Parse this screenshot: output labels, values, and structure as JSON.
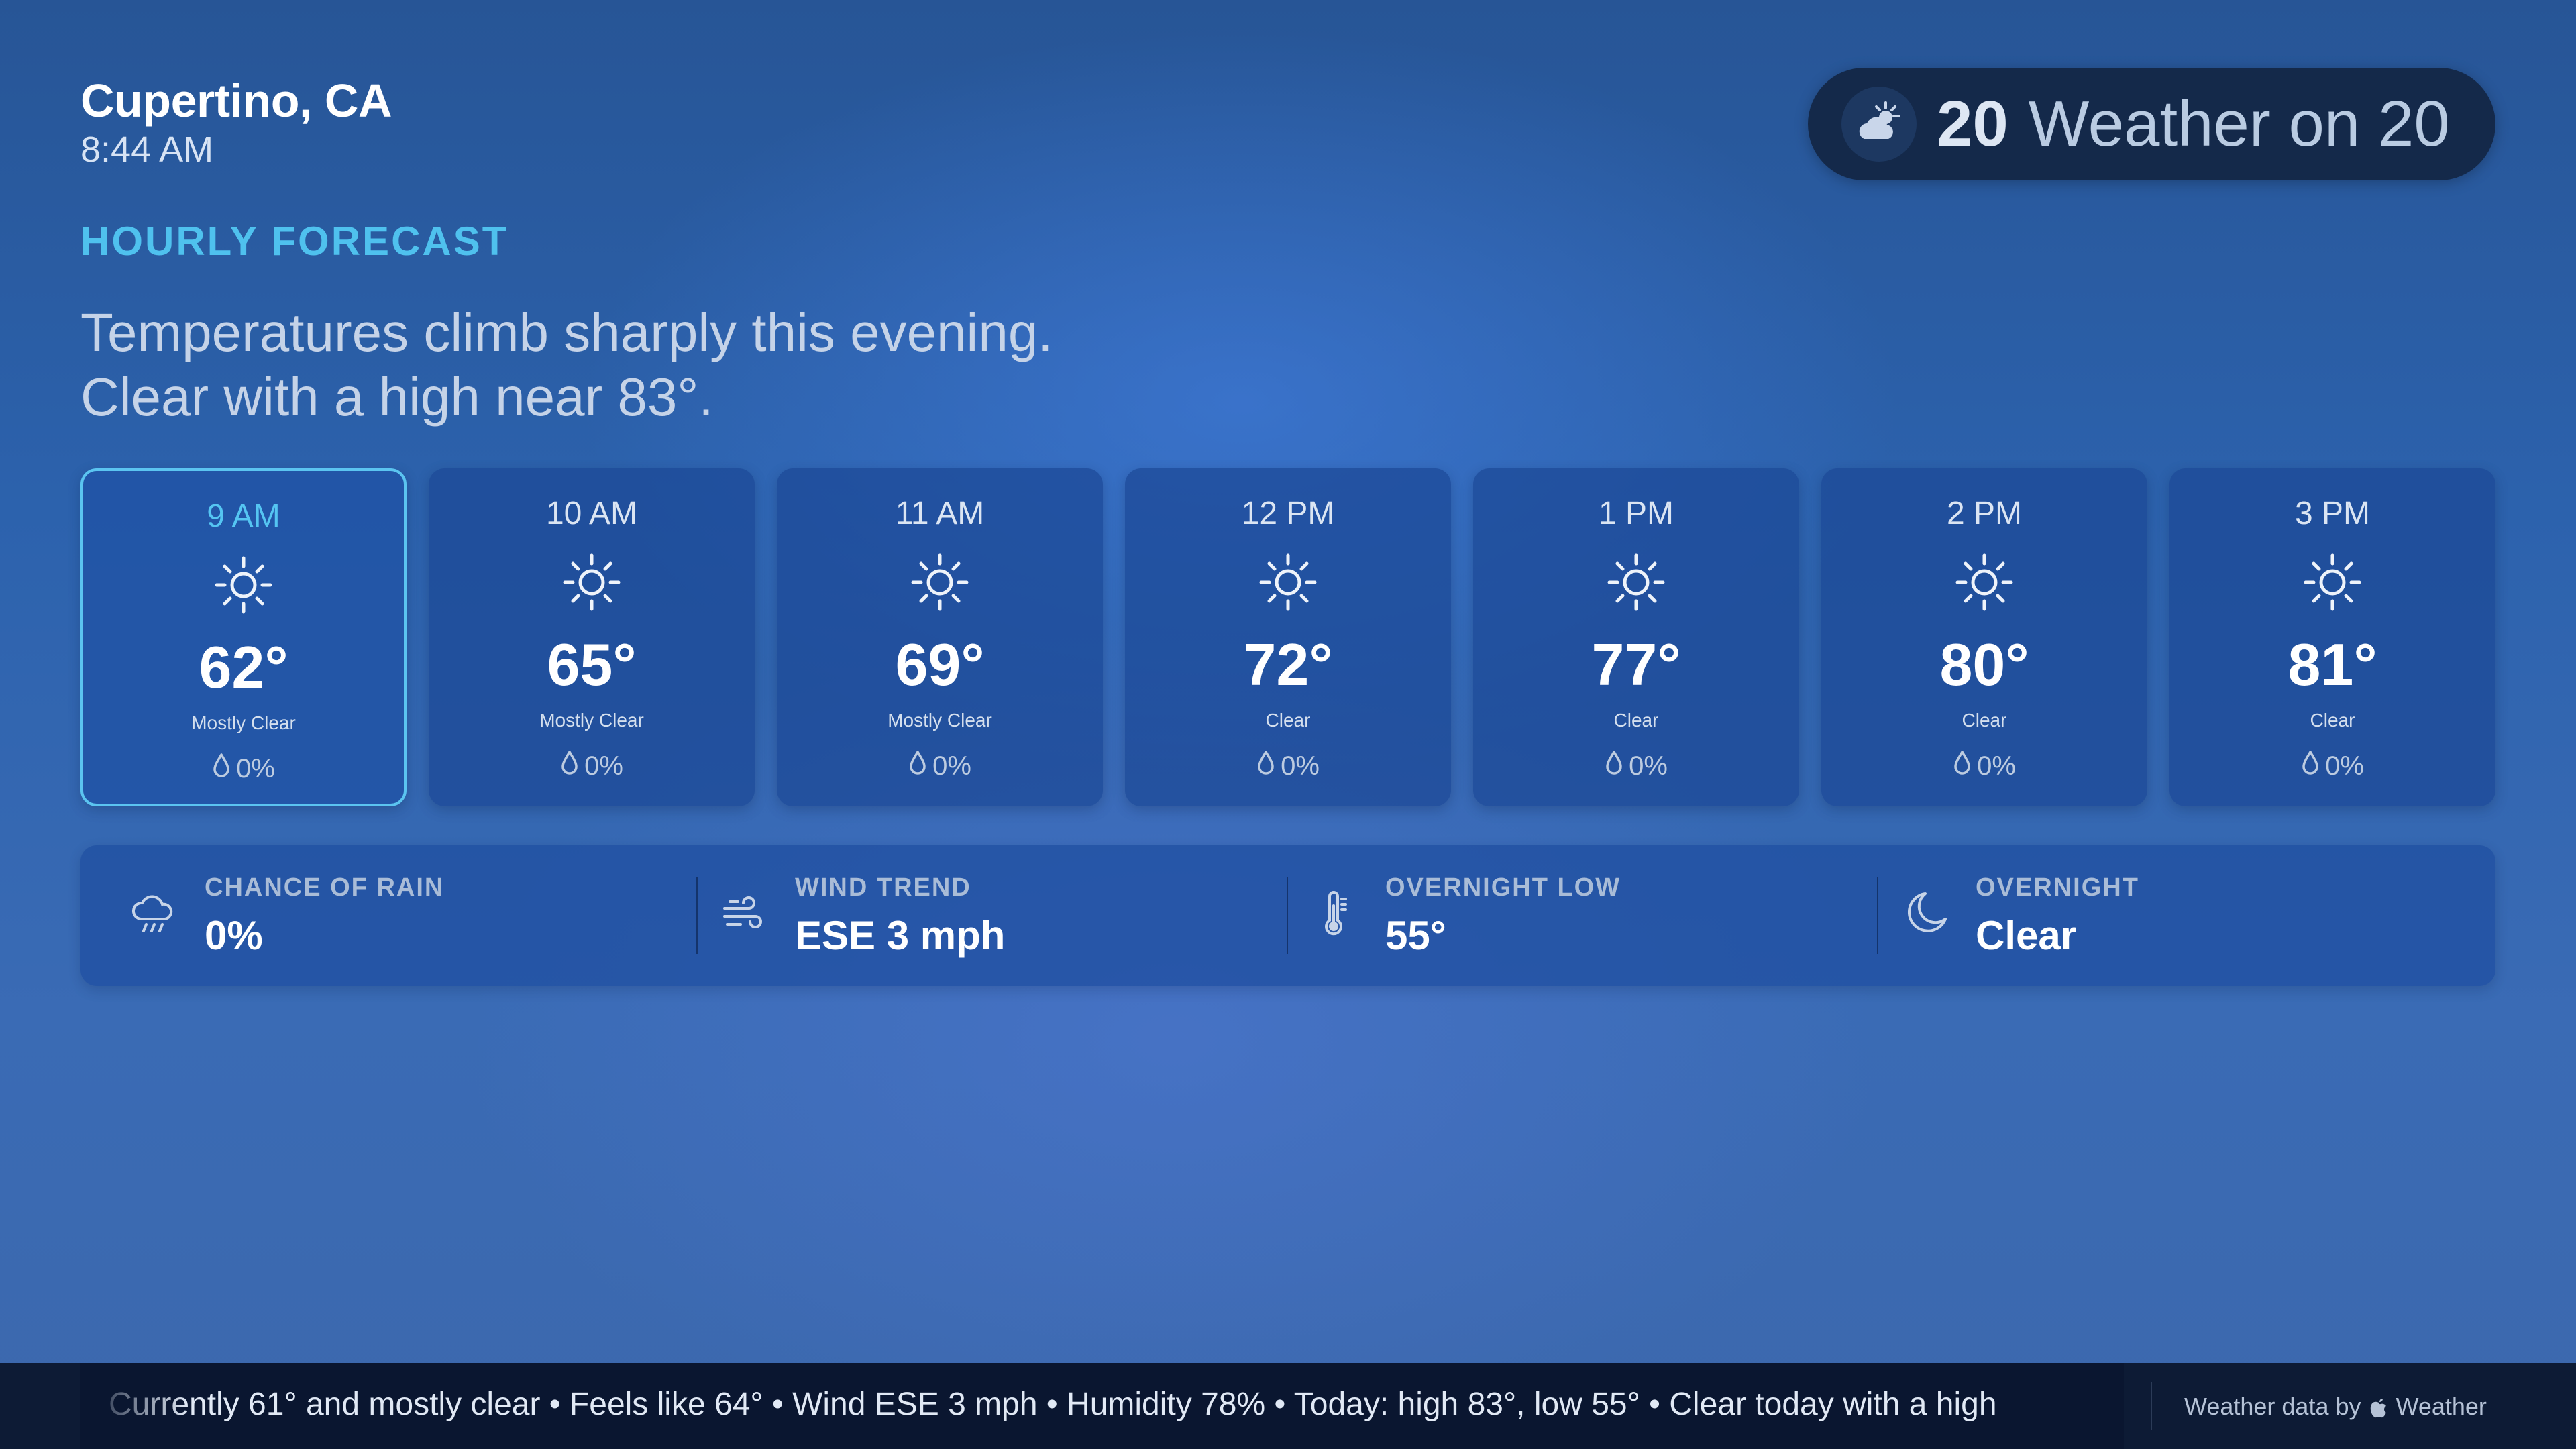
{
  "location": {
    "city": "Cupertino, CA",
    "time": "8:44 AM"
  },
  "brand": {
    "icon": "partly-cloudy-icon",
    "number": "20",
    "name": "Weather on 20"
  },
  "section_label": "HOURLY FORECAST",
  "headline": {
    "line1": "Temperatures climb sharply this evening.",
    "line2": "Clear with a high near 83°."
  },
  "hourly": [
    {
      "time": "9 AM",
      "icon": "sun-icon",
      "temp": "62°",
      "condition": "Mostly Clear",
      "precip": "0%",
      "active": true
    },
    {
      "time": "10 AM",
      "icon": "sun-icon",
      "temp": "65°",
      "condition": "Mostly Clear",
      "precip": "0%"
    },
    {
      "time": "11 AM",
      "icon": "sun-icon",
      "temp": "69°",
      "condition": "Mostly Clear",
      "precip": "0%"
    },
    {
      "time": "12 PM",
      "icon": "sun-icon",
      "temp": "72°",
      "condition": "Clear",
      "precip": "0%"
    },
    {
      "time": "1 PM",
      "icon": "sun-icon",
      "temp": "77°",
      "condition": "Clear",
      "precip": "0%"
    },
    {
      "time": "2 PM",
      "icon": "sun-icon",
      "temp": "80°",
      "condition": "Clear",
      "precip": "0%"
    },
    {
      "time": "3 PM",
      "icon": "sun-icon",
      "temp": "81°",
      "condition": "Clear",
      "precip": "0%"
    }
  ],
  "stats": [
    {
      "icon": "rain-cloud-icon",
      "label": "CHANCE OF RAIN",
      "value": "0%"
    },
    {
      "icon": "wind-icon",
      "label": "WIND TREND",
      "value": "ESE 3 mph"
    },
    {
      "icon": "thermometer-icon",
      "label": "OVERNIGHT LOW",
      "value": "55°"
    },
    {
      "icon": "moon-icon",
      "label": "OVERNIGHT",
      "value": "Clear"
    }
  ],
  "ticker": {
    "text": "Currently 61° and mostly clear   •   Feels like 64°   •   Wind ESE 3 mph   •   Humidity 78%   •   Today: high 83°, low 55°   •   Clear today with a high"
  },
  "attribution": {
    "prefix": "Weather data by",
    "icon": "apple-logo-icon",
    "name": "Weather"
  },
  "colors": {
    "accent": "#4fc1ee",
    "background": "#2c62ad",
    "card": "#1c4896",
    "brand_pill": "#14294a"
  }
}
